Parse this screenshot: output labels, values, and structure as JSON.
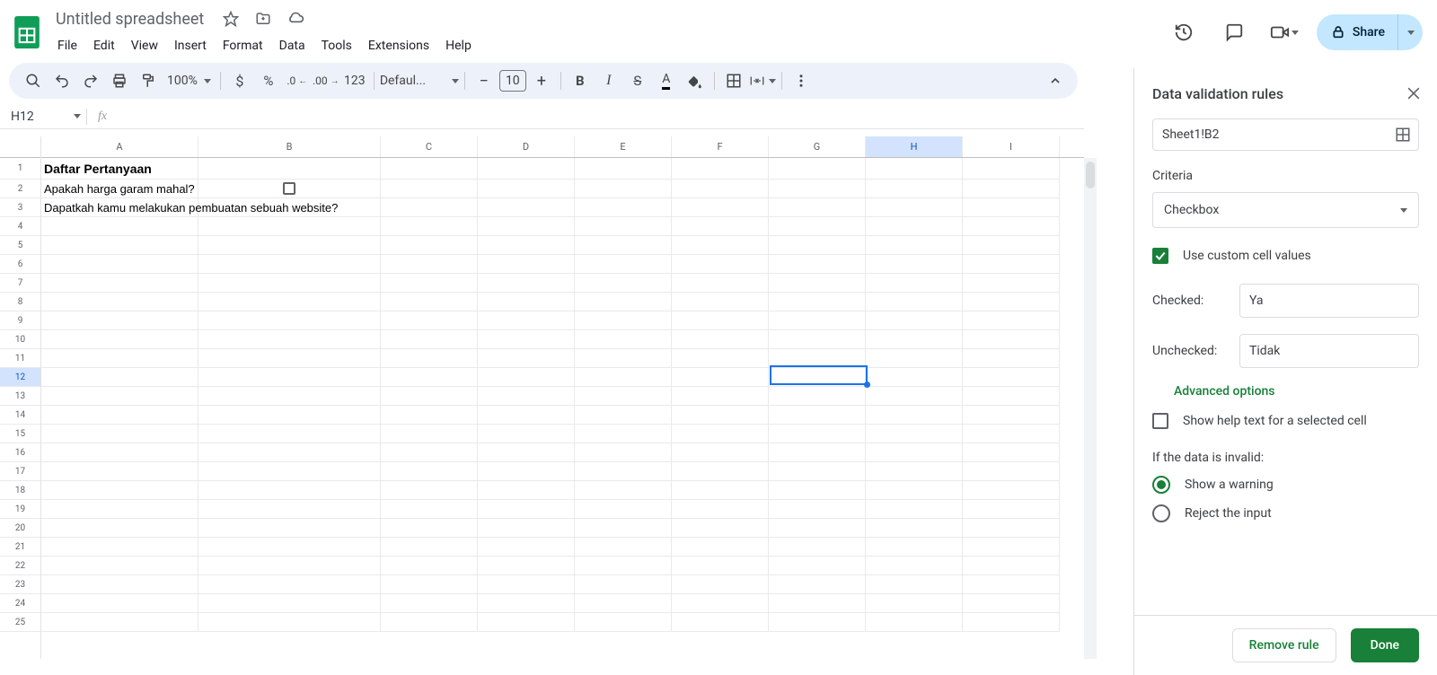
{
  "doc_title": "Untitled spreadsheet",
  "menus": [
    "File",
    "Edit",
    "View",
    "Insert",
    "Format",
    "Data",
    "Tools",
    "Extensions",
    "Help"
  ],
  "share_label": "Share",
  "toolbar": {
    "zoom": "100%",
    "font": "Defaul...",
    "font_size": "10",
    "currency_123": "123"
  },
  "name_box": "H12",
  "formula": "",
  "columns": [
    "A",
    "B",
    "C",
    "D",
    "E",
    "F",
    "G",
    "H",
    "I"
  ],
  "selected_col": "H",
  "selected_row": 12,
  "rows_count": 25,
  "cell_data": {
    "A1": "Daftar Pertanyaan",
    "A2": "Apakah harga garam mahal?",
    "A3": "Dapatkah kamu melakukan pembuatan sebuah website?"
  },
  "panel": {
    "title": "Data validation rules",
    "range": "Sheet1!B2",
    "criteria_label": "Criteria",
    "criteria_value": "Checkbox",
    "use_custom_label": "Use custom cell values",
    "use_custom_checked": true,
    "checked_label": "Checked:",
    "checked_value": "Ya",
    "unchecked_label": "Unchecked:",
    "unchecked_value": "Tidak",
    "advanced": "Advanced options",
    "help_text_label": "Show help text for a selected cell",
    "invalid_heading": "If the data is invalid:",
    "option_warning": "Show a warning",
    "option_reject": "Reject the input",
    "remove": "Remove rule",
    "done": "Done"
  }
}
